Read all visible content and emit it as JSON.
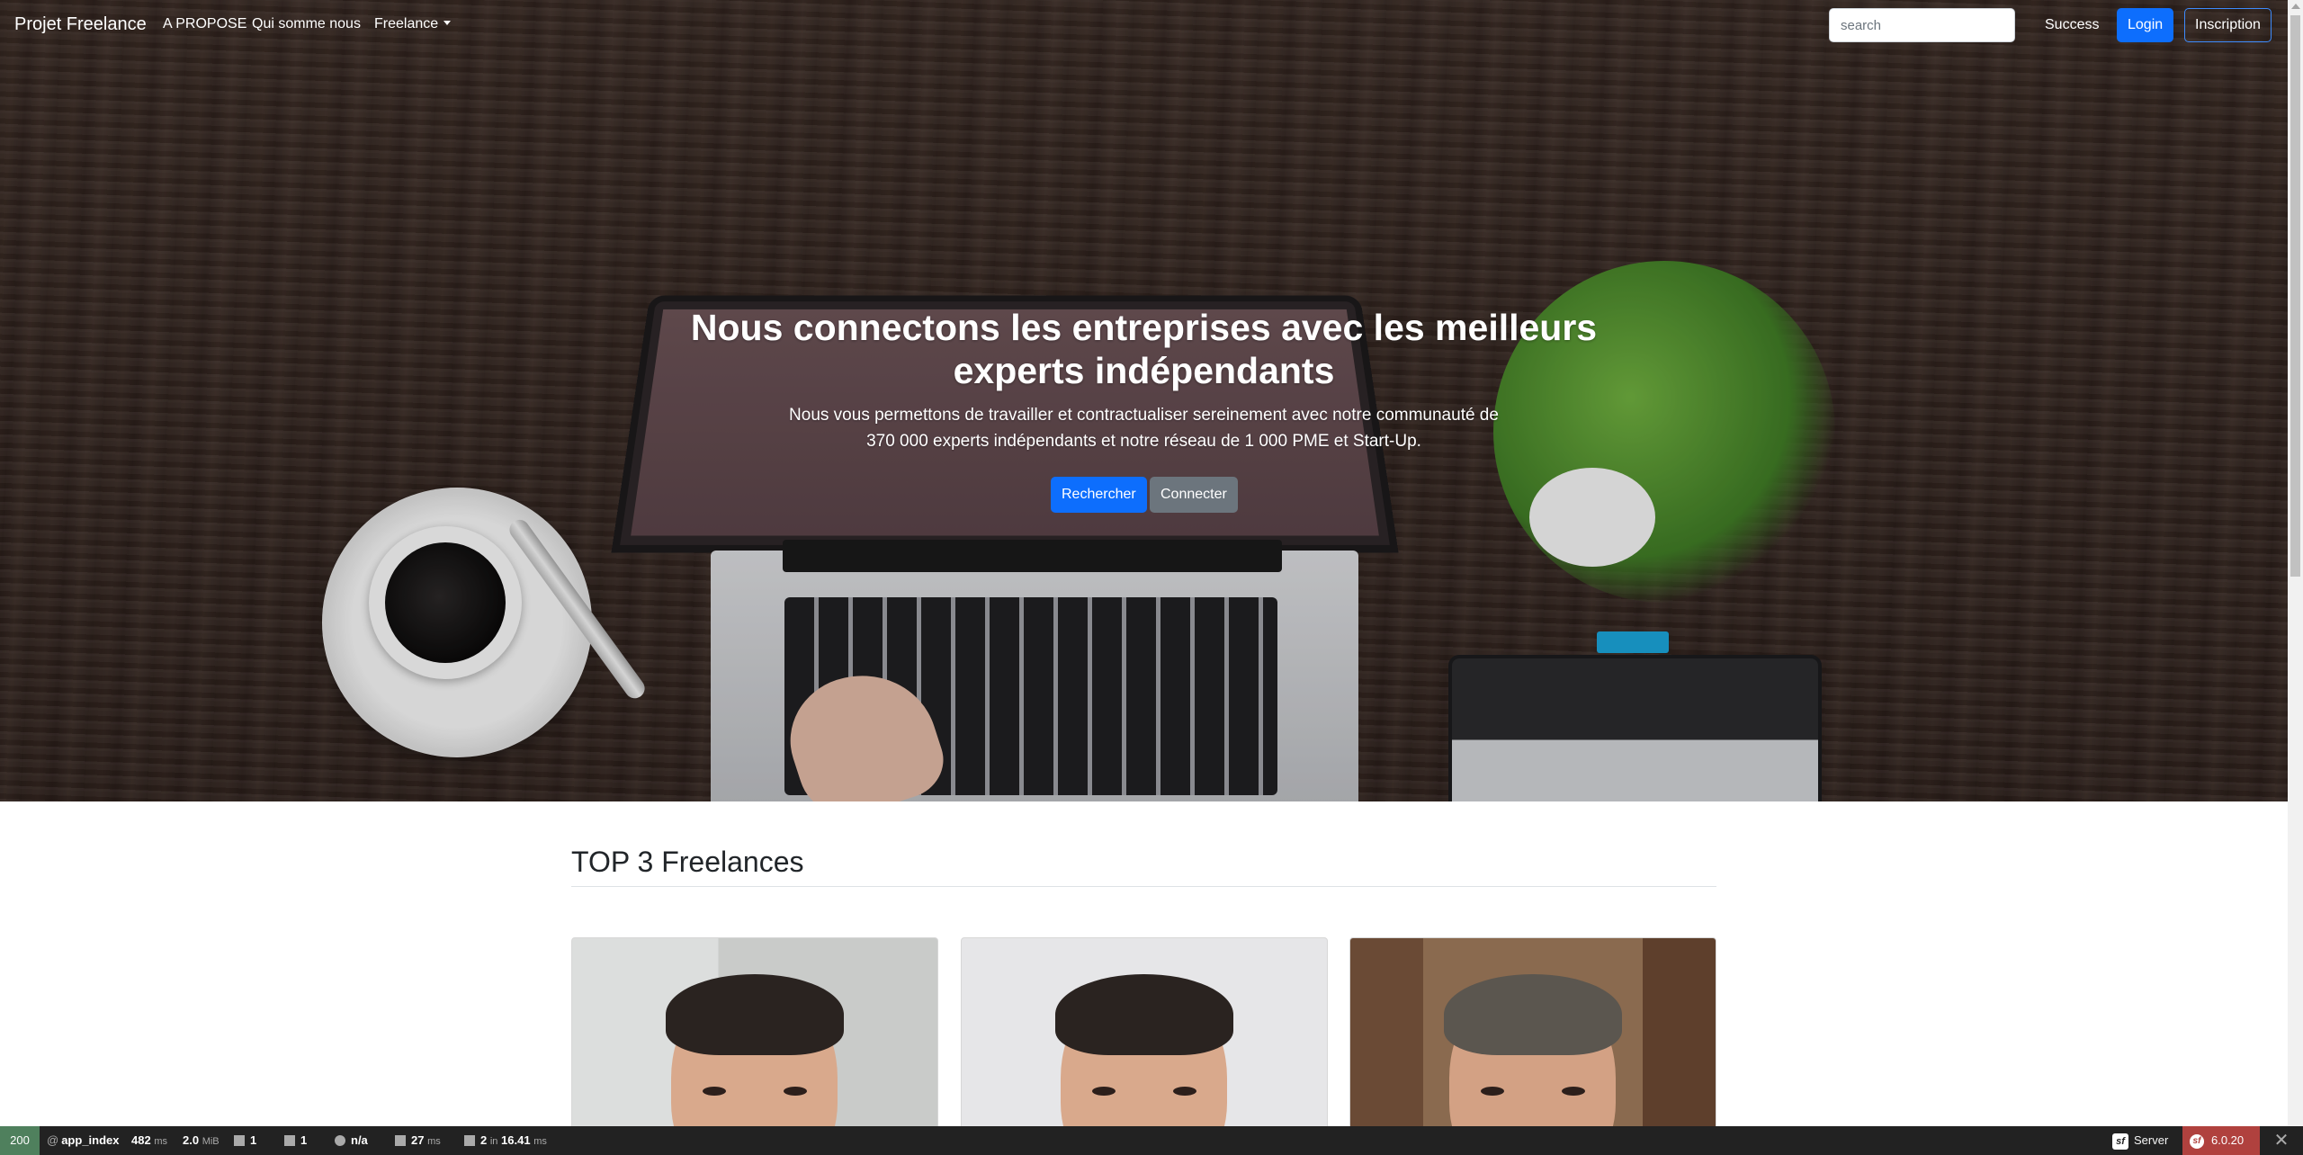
{
  "navbar": {
    "brand": "Projet Freelance",
    "links": [
      "A PROPOSE",
      "Qui somme nous",
      "Freelance"
    ],
    "search_placeholder": "search",
    "success_label": "Success",
    "login_label": "Login",
    "inscription_label": "Inscription"
  },
  "hero": {
    "title": "Nous connectons les entreprises avec les meilleurs experts indépendants",
    "subtitle": "Nous vous permettons de travailler et contractualiser sereinement avec notre communauté de 370 000 experts indépendants et notre réseau de 1 000 PME et Start-Up.",
    "search_button": "Rechercher",
    "connect_button": "Connecter"
  },
  "top_section": {
    "title": "TOP 3 Freelances"
  },
  "debug_toolbar": {
    "status_code": "200",
    "route": "app_index",
    "time_value": "482",
    "time_unit": "ms",
    "memory_value": "2.0",
    "memory_unit": "MiB",
    "forms_count": "1",
    "logs_count": "1",
    "user": "n/a",
    "events_value": "27",
    "events_unit": "ms",
    "db_queries": "2",
    "db_in": "in",
    "db_time": "16.41",
    "db_unit": "ms",
    "server_label": "Server",
    "symfony_version": "6.0.20",
    "colors": {
      "status": "#4f805d",
      "version": "#b0413e",
      "bar": "#222222"
    }
  },
  "colors": {
    "primary": "#0d6efd",
    "secondary": "#6c757d"
  }
}
